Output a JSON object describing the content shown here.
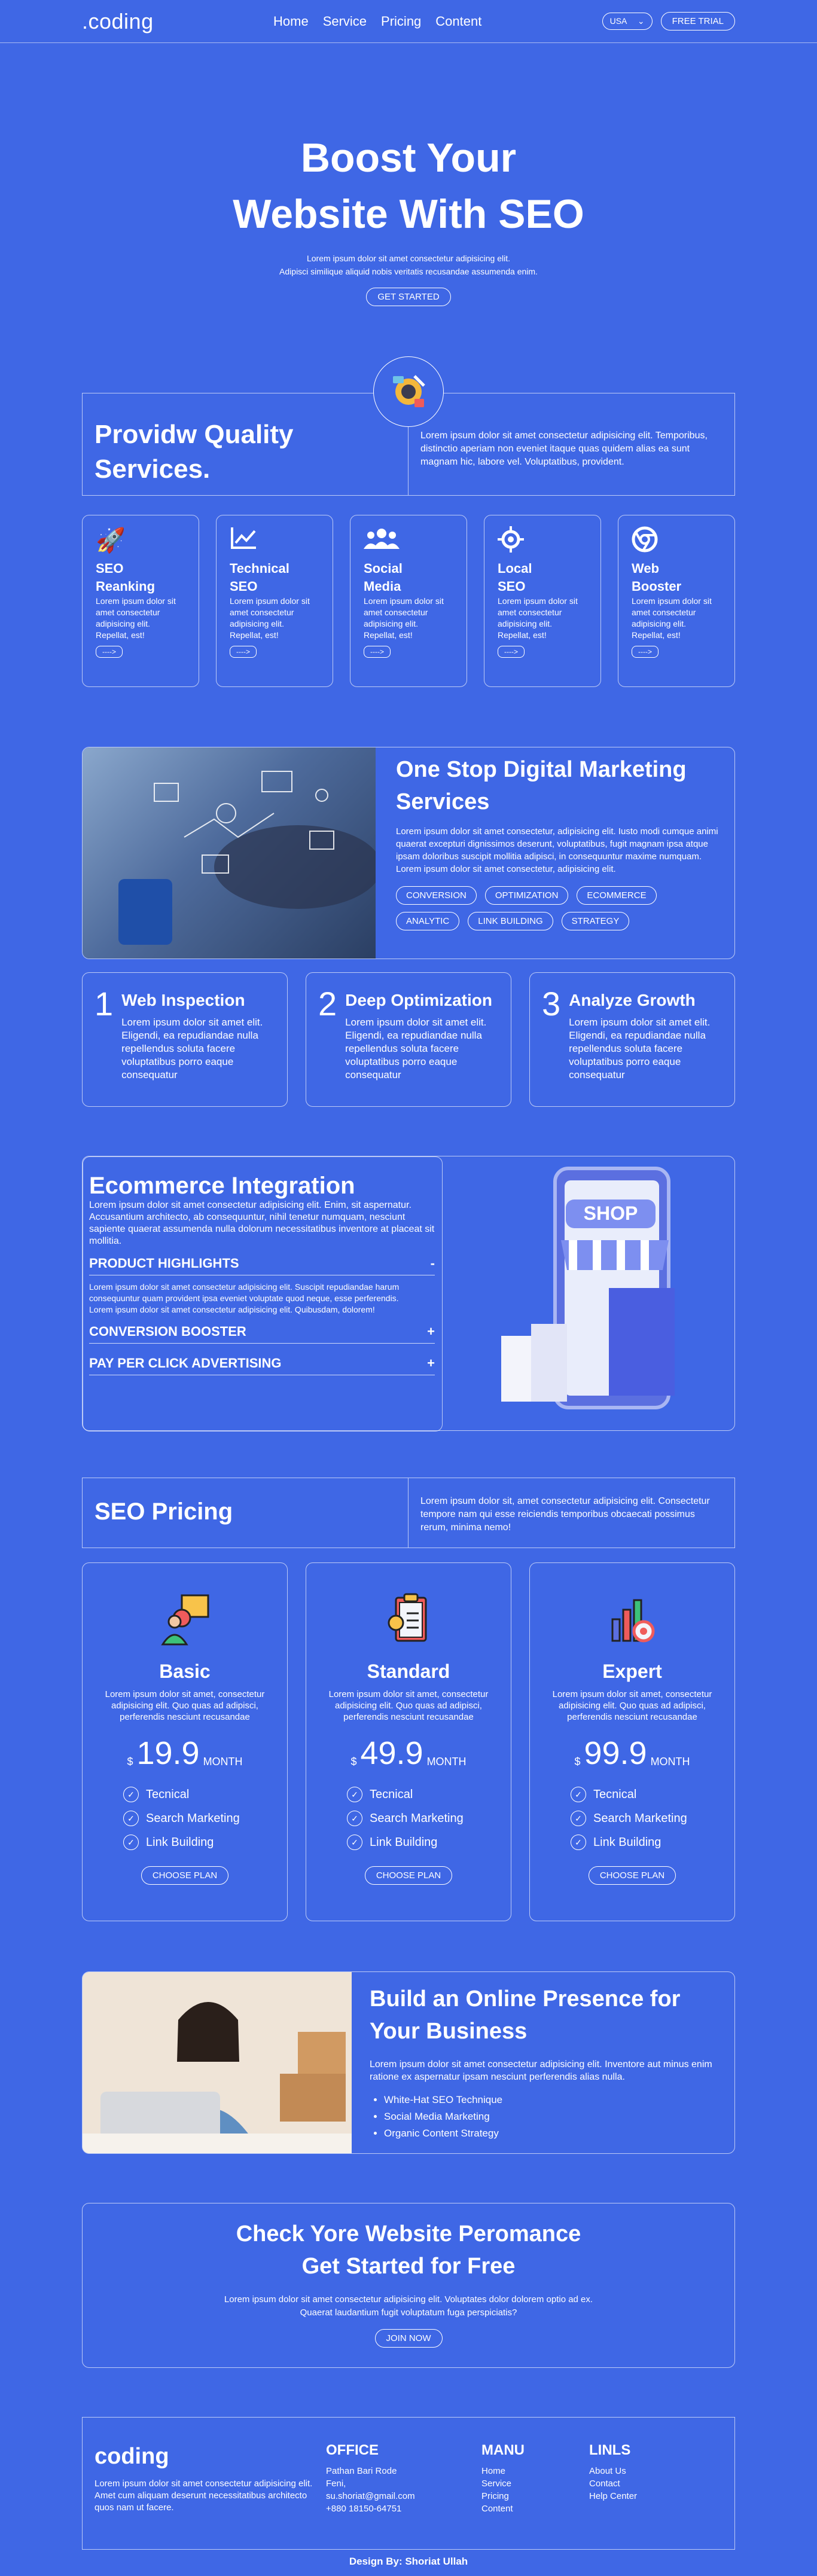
{
  "nav": {
    "logo": ".coding",
    "links": [
      "Home",
      "Service",
      "Pricing",
      "Content"
    ],
    "country": "USA",
    "trial": "FREE TRIAL"
  },
  "hero": {
    "title1": "Boost Your",
    "title2": "Website With SEO",
    "p1": "Lorem ipsum dolor sit amet consectetur adipisicing elit.",
    "p2": "Adipisci similique aliquid nobis veritatis recusandae assumenda enim.",
    "cta": "GET STARTED"
  },
  "services": {
    "title": "Providw Quality Services.",
    "text": "Lorem ipsum dolor sit amet consectetur adipisicing elit. Temporibus, distinctio aperiam non eveniet itaque quas quidem alias ea sunt magnam hic, labore vel. Voluptatibus, provident.",
    "cards": [
      {
        "t1": "SEO",
        "t2": "Reanking",
        "icon": "rocket-icon",
        "glyph": "🚀"
      },
      {
        "t1": "Technical",
        "t2": "SEO",
        "icon": "chart-line-icon",
        "glyph": "📈"
      },
      {
        "t1": "Social",
        "t2": "Media",
        "icon": "users-icon",
        "glyph": "👥"
      },
      {
        "t1": "Local",
        "t2": "SEO",
        "icon": "crosshair-icon",
        "glyph": "⌖"
      },
      {
        "t1": "Web",
        "t2": "Booster",
        "icon": "chrome-icon",
        "glyph": "◎"
      }
    ],
    "card_text": "Lorem ipsum dolor sit amet consectetur adipisicing elit. Repellat, est!",
    "arrow": "---->"
  },
  "digital": {
    "title": "One Stop Digital Marketing Services",
    "text": "Lorem ipsum dolor sit amet consectetur, adipisicing elit. Iusto modi cumque animi quaerat excepturi dignissimos deserunt, voluptatibus, fugit magnam ipsa atque ipsam doloribus suscipit mollitia adipisci, in consequuntur maxime numquam. Lorem ipsum dolor sit amet consectetur, adipisicing elit.",
    "tags": [
      "CONVERSION",
      "OPTIMIZATION",
      "ECOMMERCE",
      "ANALYTIC",
      "LINK BUILDING",
      "STRATEGY"
    ]
  },
  "steps": [
    {
      "n": "1",
      "title": "Web Inspection",
      "text": "Lorem ipsum dolor sit amet elit. Eligendi, ea repudiandae nulla repellendus soluta facere voluptatibus porro eaque consequatur"
    },
    {
      "n": "2",
      "title": "Deep Optimization",
      "text": "Lorem ipsum dolor sit amet elit. Eligendi, ea repudiandae nulla repellendus soluta facere voluptatibus porro eaque consequatur"
    },
    {
      "n": "3",
      "title": "Analyze Growth",
      "text": "Lorem ipsum dolor sit amet elit. Eligendi, ea repudiandae nulla repellendus soluta facere voluptatibus porro eaque consequatur"
    }
  ],
  "ecommerce": {
    "title": "Ecommerce Integration",
    "text": "Lorem ipsum dolor sit amet consectetur adipisicing elit. Enim, sit aspernatur. Accusantium architecto, ab consequuntur, nihil tenetur numquam, nesciunt sapiente quaerat assumenda nulla dolorum necessitatibus inventore at placeat sit mollitia.",
    "acc1": "PRODUCT HIGHLIGHTS",
    "acc1_sign": "-",
    "acc1_text": "Lorem ipsum dolor sit amet consectetur adipisicing elit. Suscipit repudiandae harum consequuntur quam provident ipsa eveniet voluptate quod neque, esse perferendis. Lorem ipsum dolor sit amet consectetur adipisicing elit. Quibusdam, dolorem!",
    "acc2": "CONVERSION BOOSTER",
    "acc3": "PAY PER CLICK ADVERTISING",
    "plus": "+",
    "shop": "SHOP"
  },
  "pricing": {
    "title": "SEO Pricing",
    "text": "Lorem ipsum dolor sit, amet consectetur adipisicing elit. Consectetur tempore nam qui esse reiciendis temporibus obcaecati possimus rerum, minima nemo!",
    "plans": [
      {
        "name": "Basic",
        "price": "19.9",
        "icon": "target-person-icon"
      },
      {
        "name": "Standard",
        "price": "49.9",
        "icon": "clipboard-award-icon"
      },
      {
        "name": "Expert",
        "price": "99.9",
        "icon": "bar-chart-target-icon"
      }
    ],
    "desc": "Lorem ipsum dolor sit amet, consectetur adipisicing elit. Quo quas ad adipisci, perferendis nesciunt recusandae",
    "currency": "$",
    "period": "MONTH",
    "features": [
      "Tecnical",
      "Search Marketing",
      "Link Building"
    ],
    "button": "CHOOSE PLAN"
  },
  "online": {
    "title": "Build an Online Presence for Your Business",
    "text": "Lorem ipsum dolor sit amet consectetur adipisicing elit. Inventore aut minus enim ratione ex aspernatur ipsam nesciunt perferendis alias nulla.",
    "items": [
      "White-Hat SEO Technique",
      "Social Media Marketing",
      "Organic Content Strategy"
    ]
  },
  "cta": {
    "t1": "Check Yore Website Peromance",
    "t2": "Get Started for Free",
    "p1": "Lorem ipsum dolor sit amet consectetur adipisicing elit. Voluptates dolor dolorem optio ad ex.",
    "p2": "Quaerat laudantium fugit voluptatum fuga perspiciatis?",
    "button": "JOIN NOW"
  },
  "footer": {
    "logo": "coding",
    "text": "Lorem ipsum dolor sit amet consectetur adipisicing elit. Amet cum aliquam deserunt necessitatibus architecto quos nam ut facere.",
    "office_title": "OFFICE",
    "office": [
      "Pathan Bari Rode",
      "Feni,",
      "su.shoriat@gmail.com",
      "+880 18150-64751"
    ],
    "menu_title": "MANU",
    "menu": [
      "Home",
      "Service",
      "Pricing",
      "Content"
    ],
    "links_title": "LINLS",
    "links": [
      "About Us",
      "Contact",
      "Help Center"
    ],
    "credit": "Design By: Shoriat Ullah"
  }
}
